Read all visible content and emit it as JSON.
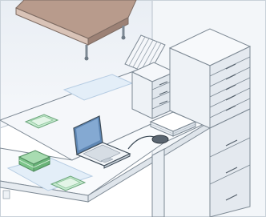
{
  "illustration": {
    "kind": "isometric office workspace",
    "objects": [
      "desk",
      "laptop",
      "mouse",
      "cash-tray",
      "document-tray",
      "drawer-cabinet",
      "file-cabinet",
      "paper-sorter",
      "paper-stack",
      "floating-shelf",
      "desk-mat"
    ]
  },
  "colors": {
    "background": "#ffffff",
    "wall": "#eef3f8",
    "outline": "#7d8994",
    "furniture": "#f2f5f8",
    "laptop_screen": "#7ba3cf",
    "mat_blue": "#e3eef8",
    "tray_green": "#bfe6c8",
    "cash_green": "#8fd39a",
    "shelf_wood": "#c7aa9b"
  }
}
